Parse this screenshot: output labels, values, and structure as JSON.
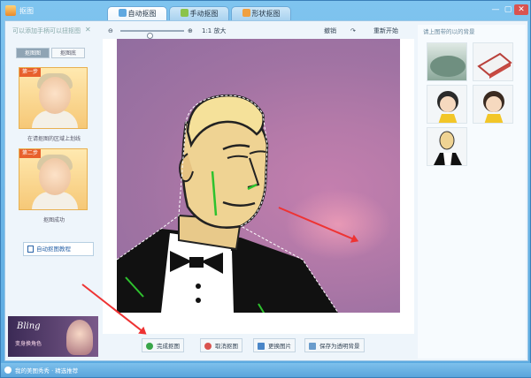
{
  "window": {
    "title": "抠图",
    "min": "—",
    "max": "▢",
    "close": "✕"
  },
  "tabs": [
    {
      "label": "自动抠图",
      "active": true
    },
    {
      "label": "手动抠图",
      "active": false
    },
    {
      "label": "形状抠图",
      "active": false
    }
  ],
  "left_panel": {
    "title": "可以添加手柄可以扭抠图",
    "close": "✕",
    "subtabs": [
      "抠图图",
      "抠图底"
    ],
    "thumb1": {
      "badge": "第一步",
      "caption": "在请抠图的区域上划线"
    },
    "thumb2": {
      "badge": "第二步",
      "caption": "抠图成功"
    },
    "tutorial": "自动抠图教程"
  },
  "toolbar": {
    "zoom_out": "⊖",
    "zoom_in": "⊕",
    "zoom_label": "1:1 放大",
    "undo": "撤销",
    "redo": "↷",
    "reset": "重新开始"
  },
  "bottom_buttons": [
    {
      "label": "完成抠图",
      "color": "#3aa64a"
    },
    {
      "label": "取消抠图",
      "color": "#d9534f"
    },
    {
      "label": "更换图片",
      "color": "#4a86c8"
    },
    {
      "label": "保存为透明背景",
      "color": "#6a9ccc"
    }
  ],
  "right_panel": {
    "title": "请上图带的以的背景"
  },
  "ad": {
    "title": "Bling",
    "subtitle": "变身换角色"
  },
  "status": {
    "text": "我的美图秀秀 · 精选推荐"
  }
}
